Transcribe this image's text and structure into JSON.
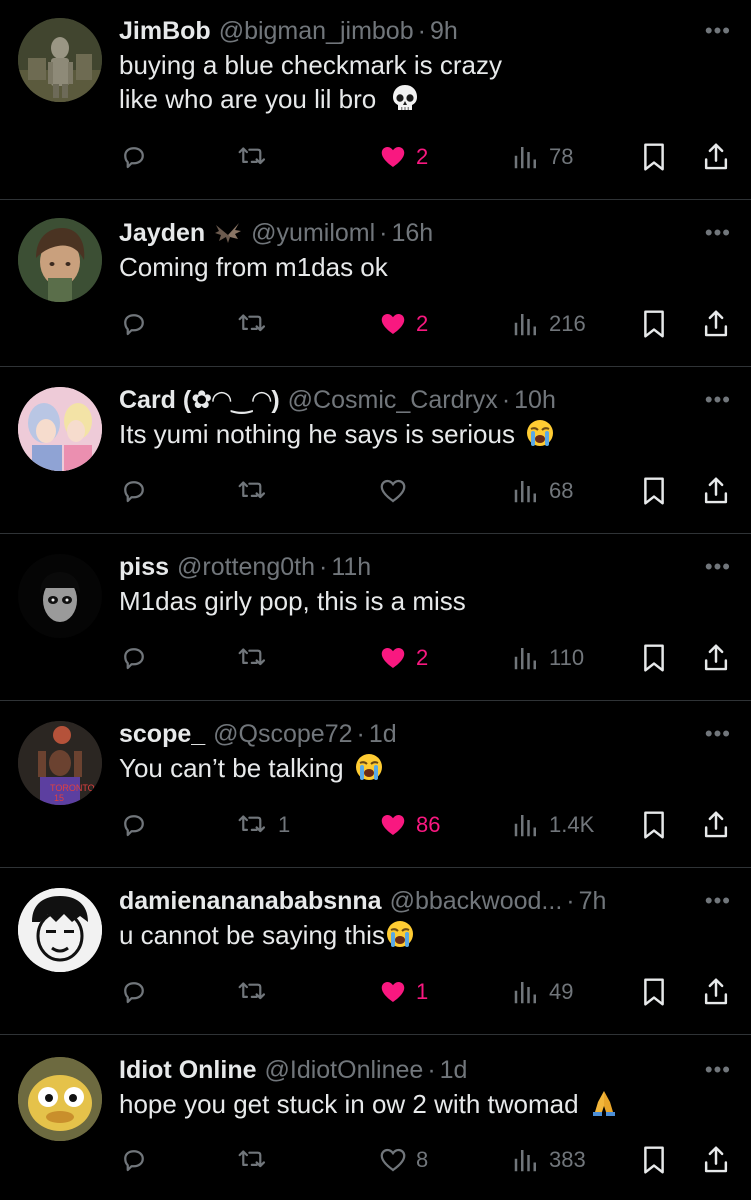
{
  "colors": {
    "background": "#000000",
    "text": "#e7e9ea",
    "muted": "#71767b",
    "like_active": "#f91880",
    "divider": "#2f3336"
  },
  "replies": [
    {
      "name": "JimBob",
      "handle": "@bigman_jimbob",
      "time": "9h",
      "lines": [
        "buying a blue checkmark is crazy",
        "like who are you lil bro"
      ],
      "emoji": "skull-emoji",
      "replies": "",
      "retweets": "",
      "likes": "2",
      "liked": true,
      "views": "78"
    },
    {
      "name": "Jayden",
      "badge": "bat-emoji",
      "handle": "@yumiloml",
      "time": "16h",
      "lines": [
        "Coming from m1das ok"
      ],
      "replies": "",
      "retweets": "",
      "likes": "2",
      "liked": true,
      "views": "216"
    },
    {
      "name": "Card (✿◠‿◠)",
      "handle": "@Cosmic_Cardryx",
      "time": "10h",
      "lines": [
        "Its yumi nothing he says is serious"
      ],
      "emoji": "loudly-crying-emoji",
      "replies": "",
      "retweets": "",
      "likes": "",
      "liked": false,
      "views": "68"
    },
    {
      "name": "piss",
      "handle": "@rotteng0th",
      "time": "11h",
      "lines": [
        "M1das girly pop, this is a miss"
      ],
      "replies": "",
      "retweets": "",
      "likes": "2",
      "liked": true,
      "views": "110"
    },
    {
      "name": "scope_",
      "handle": "@Qscope72",
      "time": "1d",
      "lines": [
        "You can’t be talking"
      ],
      "emoji": "loudly-crying-emoji",
      "replies": "",
      "retweets": "1",
      "likes": "86",
      "liked": true,
      "views": "1.4K"
    },
    {
      "name": "damienananababsnna",
      "handle": "@bbackwood...",
      "time": "7h",
      "lines": [
        "u cannot be saying this"
      ],
      "emoji": "loudly-crying-emoji",
      "replies": "",
      "retweets": "",
      "likes": "1",
      "liked": true,
      "views": "49"
    },
    {
      "name": "Idiot Online",
      "handle": "@IdiotOnlinee",
      "time": "1d",
      "lines": [
        "hope you get stuck in ow 2 with twomad"
      ],
      "emoji": "folded-hands-emoji",
      "replies": "",
      "retweets": "",
      "likes": "8",
      "liked": false,
      "views": "383"
    }
  ]
}
